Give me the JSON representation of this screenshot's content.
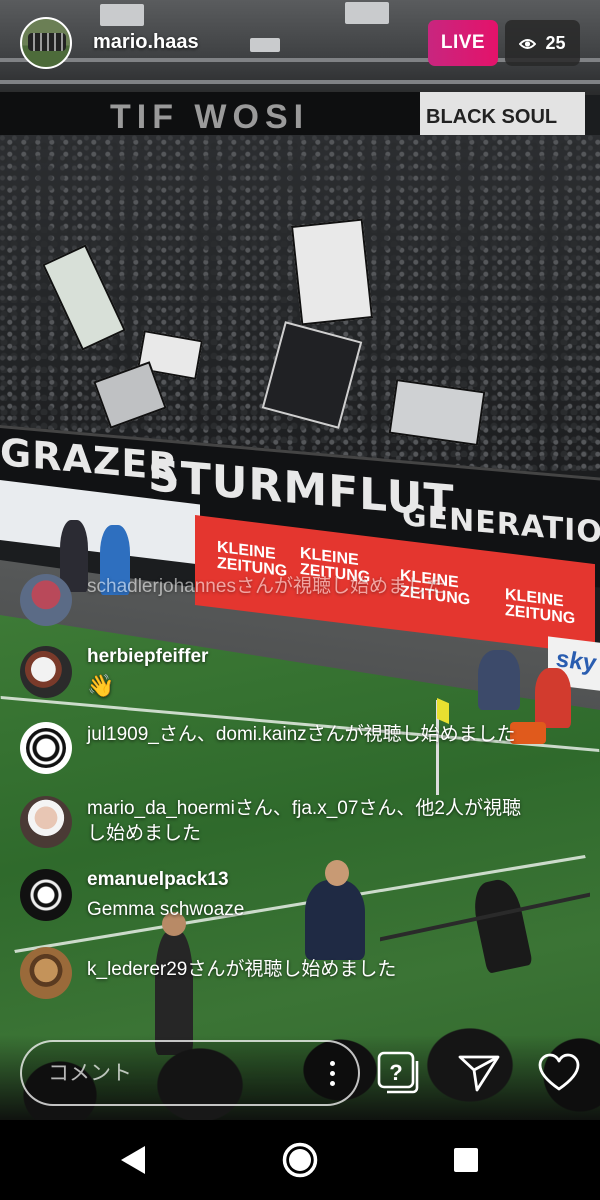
{
  "stream": {
    "host_username": "mario.haas",
    "live_label": "LIVE",
    "viewer_count": "25"
  },
  "comments": [
    {
      "type": "join",
      "text": "schadlerjohannesさんが視聴し始めました",
      "avatar": "red-figure-avatar"
    },
    {
      "type": "message",
      "username": "herbiepfeiffer",
      "text": "👋",
      "avatar": "dog-avatar"
    },
    {
      "type": "join",
      "text": "jul1909_さん、domi.kainzさんが視聴し始めました",
      "avatar": "sturm-crest-avatar"
    },
    {
      "type": "join",
      "text": "mario_da_hoermiさん、fja.x_07さん、他2人が視聴し始めました",
      "avatar": "sunglasses-avatar"
    },
    {
      "type": "message",
      "username": "emanuelpack13",
      "text": "Gemma schwoaze",
      "avatar": "sturm-crest-dark-avatar"
    },
    {
      "type": "join",
      "text": "k_lederer29さんが視聴し始めました",
      "avatar": "man-avatar"
    }
  ],
  "background": {
    "banner_upper_left": "TIF  WOSI",
    "banner_upper_right": "BLACK SOUL",
    "banner_grazer": "GRAZER",
    "banner_sturmflut": "STURMFLUT",
    "banner_generation": "GENERATION",
    "ad_brand": "KLEINE ZEITUNG",
    "sky_logo": "sky"
  },
  "composer": {
    "placeholder": "コメント"
  },
  "actions": [
    "question-icon",
    "send-icon",
    "heart-icon"
  ],
  "nav": [
    "back-icon",
    "home-icon",
    "recents-icon"
  ],
  "colors": {
    "live_gradient_start": "#c8267f",
    "live_gradient_end": "#e4126a",
    "pitch_green": "#3d7a36",
    "ad_red": "#e4362f"
  }
}
